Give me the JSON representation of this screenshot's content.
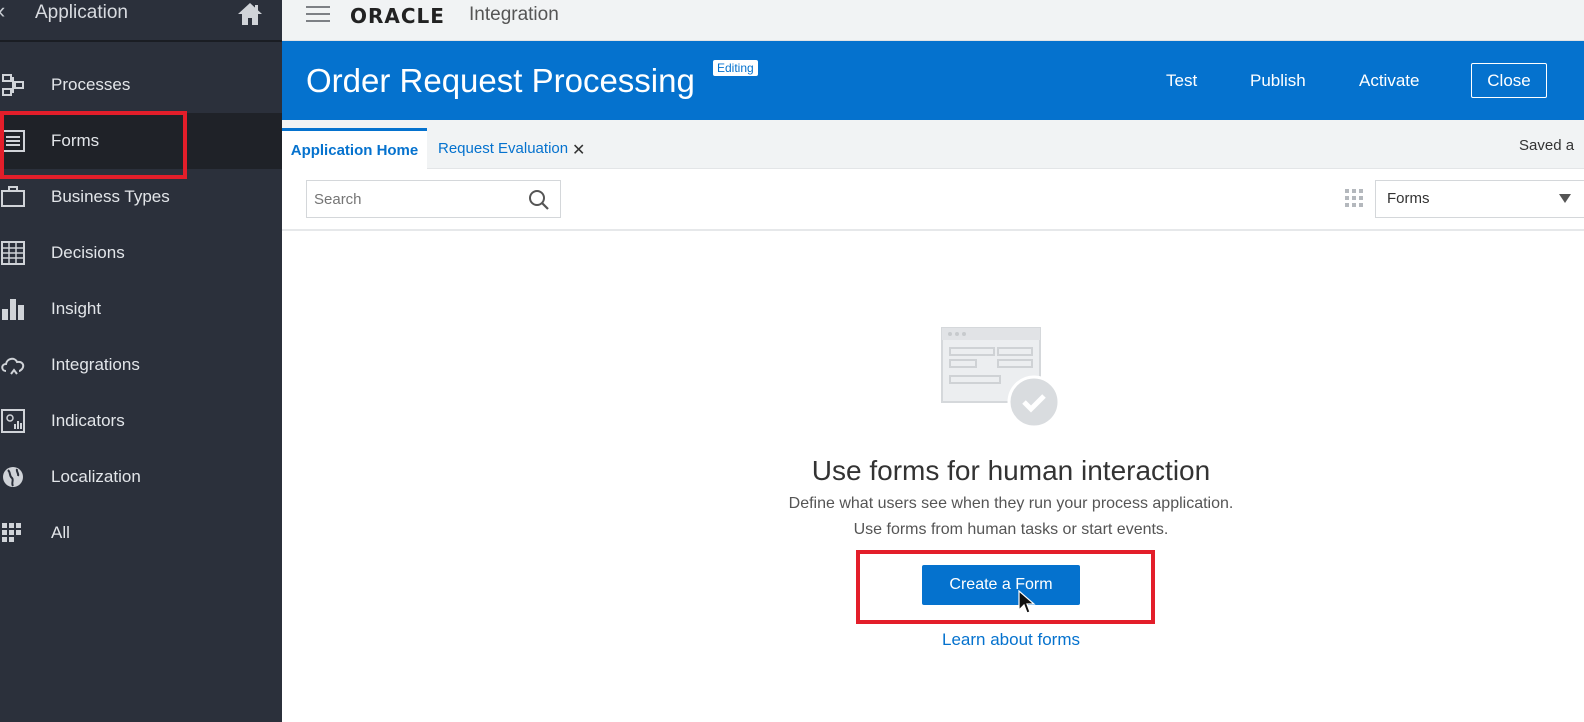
{
  "sidebar": {
    "title": "Application",
    "items": [
      {
        "label": "Processes",
        "icon": "processes-icon"
      },
      {
        "label": "Forms",
        "icon": "forms-icon",
        "active": true
      },
      {
        "label": "Business Types",
        "icon": "briefcase-icon"
      },
      {
        "label": "Decisions",
        "icon": "table-icon"
      },
      {
        "label": "Insight",
        "icon": "bar-chart-icon"
      },
      {
        "label": "Integrations",
        "icon": "cloud-icon"
      },
      {
        "label": "Indicators",
        "icon": "indicator-icon"
      },
      {
        "label": "Localization",
        "icon": "globe-icon"
      },
      {
        "label": "All",
        "icon": "all-grid-icon"
      }
    ]
  },
  "topbar": {
    "brand": "ORACLE",
    "product": "Integration"
  },
  "titlebar": {
    "title": "Order Request Processing",
    "badge": "Editing",
    "test_label": "Test",
    "publish_label": "Publish",
    "activate_label": "Activate",
    "close_label": "Close"
  },
  "tabs": {
    "home_label": "Application Home",
    "request_label": "Request Evaluation",
    "close_glyph": "✕",
    "saved_text": "Saved a"
  },
  "filter": {
    "search_placeholder": "Search",
    "select_value": "Forms"
  },
  "empty_state": {
    "title": "Use forms for human interaction",
    "desc1": "Define what users see when they run your process application.",
    "desc2": "Use forms from human tasks or start events.",
    "create_label": "Create a Form",
    "learn_label": "Learn about forms"
  },
  "colors": {
    "accent": "#0572ce",
    "sidebar_bg": "#2b303b",
    "highlight": "#e31e2a"
  }
}
